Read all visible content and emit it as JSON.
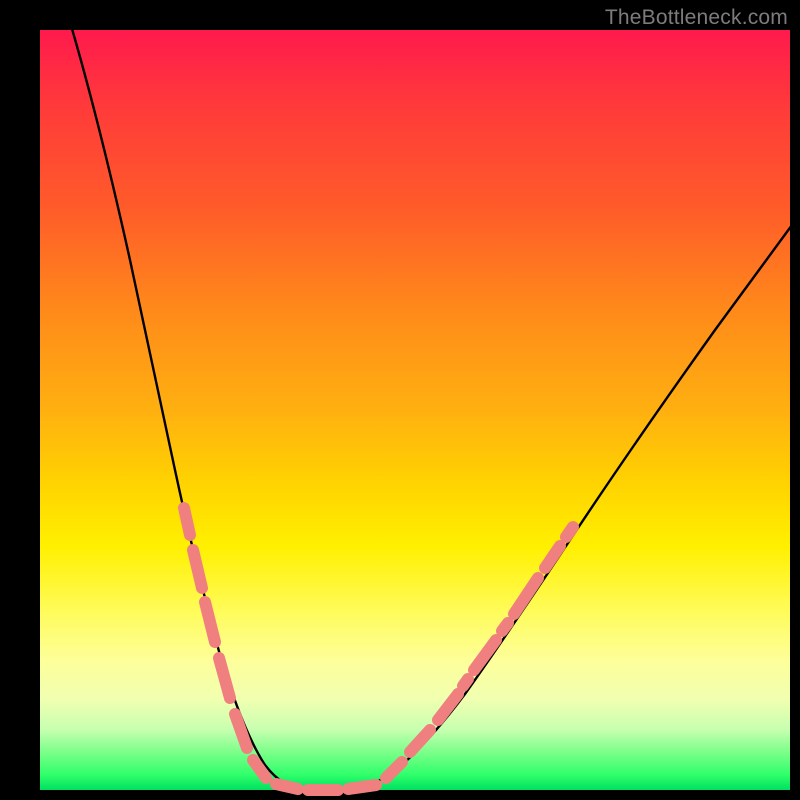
{
  "watermark": "TheBottleneck.com",
  "chart_data": {
    "type": "line",
    "title": "",
    "xlabel": "",
    "ylabel": "",
    "xlim": [
      0,
      100
    ],
    "ylim": [
      0,
      100
    ],
    "series": [
      {
        "name": "bottleneck-curve",
        "x": [
          5,
          8,
          11,
          14,
          17,
          20,
          22,
          24,
          26,
          28,
          30,
          32,
          34,
          36,
          38,
          40,
          43,
          46,
          50,
          55,
          60,
          66,
          72,
          78,
          84,
          90,
          96,
          100
        ],
        "y": [
          100,
          90,
          80,
          70,
          60,
          50,
          43,
          36,
          30,
          24,
          18,
          13,
          9,
          5,
          2.5,
          1,
          0,
          1,
          4,
          10,
          18,
          28,
          38,
          48,
          57,
          64,
          70,
          74
        ]
      }
    ],
    "highlight_segments": {
      "name": "salmon-dashes",
      "description": "short dashed highlight segments near the bottom of the V",
      "left_branch_x_range": [
        20,
        34
      ],
      "right_branch_x_range": [
        44,
        58
      ],
      "valley_x_range": [
        32,
        48
      ]
    },
    "background_gradient": {
      "top": "#ff1a4d",
      "upper_mid": "#ff8a1a",
      "mid": "#ffd400",
      "lower_mid": "#fffb55",
      "bottom": "#00e060"
    }
  }
}
